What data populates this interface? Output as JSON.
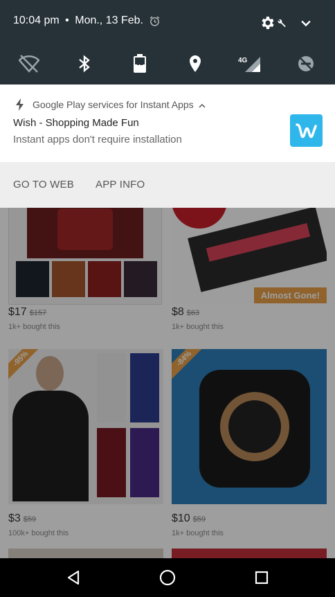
{
  "status": {
    "time": "10:04 pm",
    "date": "Mon., 13 Feb.",
    "battery_level": "52"
  },
  "notification": {
    "app_name": "Google Play services for Instant Apps",
    "title": "Wish - Shopping Made Fun",
    "subtitle": "Instant apps don't require installation",
    "actions": [
      "GO TO WEB",
      "APP INFO"
    ],
    "logo_color": "#2fb7ec"
  },
  "feed": {
    "products": [
      {
        "price": "$17",
        "was": "$157",
        "bought": "1k+ bought this",
        "badge": ""
      },
      {
        "price": "$8",
        "was": "$63",
        "bought": "1k+ bought this",
        "badge": "Almost Gone!"
      },
      {
        "price": "$3",
        "was": "$59",
        "bought": "100k+ bought this",
        "badge": "-95%"
      },
      {
        "price": "$10",
        "was": "$59",
        "bought": "1k+ bought this",
        "badge": "-84%"
      }
    ],
    "accent_color": "#e8a04a"
  }
}
